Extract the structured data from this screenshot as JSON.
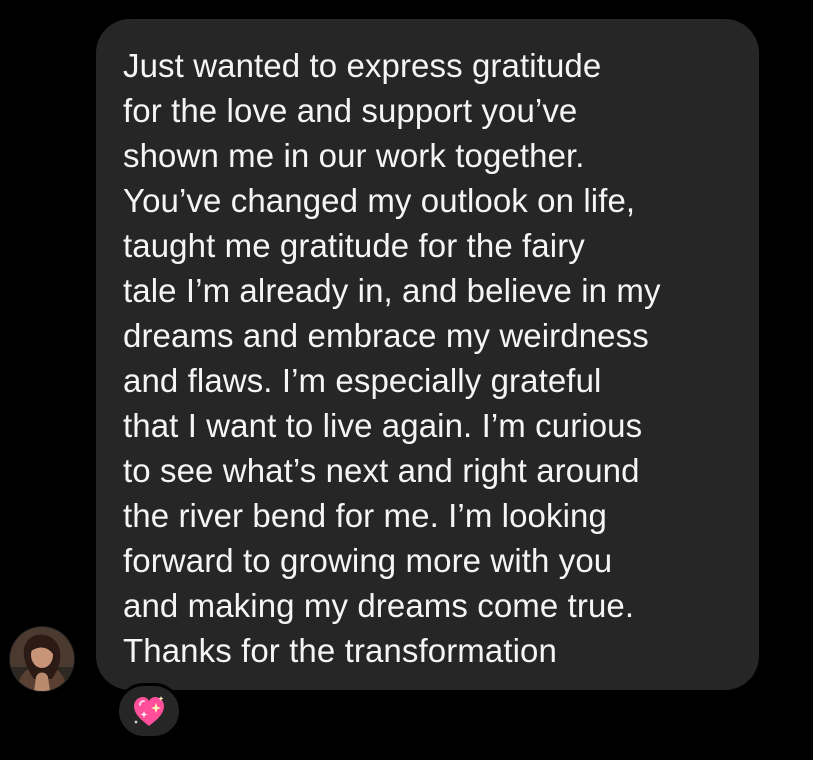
{
  "message": {
    "lines": [
      "Just wanted to express gratitude",
      "for the love and support you’ve",
      "shown me in our work together.",
      "You’ve changed my outlook on life,",
      "taught me gratitude for the fairy",
      "tale I’m already in, and believe in my",
      "dreams and embrace my weirdness",
      "and flaws. I’m especially grateful",
      "that I want to live again. I’m curious",
      "to see what’s next and right around",
      "the river bend for me. I’m looking",
      "forward to growing more with you",
      "and making my dreams come true.",
      "Thanks for the transformation"
    ]
  },
  "reaction": {
    "icon": "sparkling-heart-icon"
  },
  "colors": {
    "background": "#000000",
    "bubble": "#262626",
    "text": "#f5f5f5",
    "heart": "#ff4f9a"
  }
}
